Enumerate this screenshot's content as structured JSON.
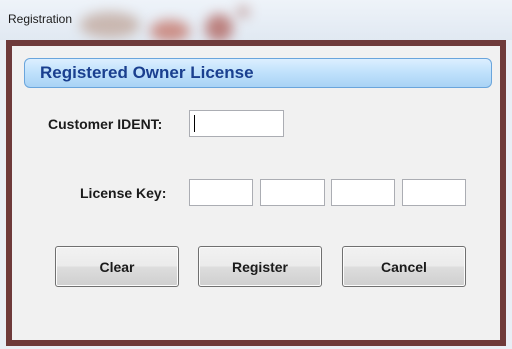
{
  "window": {
    "title": "Registration"
  },
  "header": {
    "title": "Registered Owner License"
  },
  "form": {
    "customer_ident_label": "Customer IDENT:",
    "customer_ident_value": "",
    "license_key_label": "License Key:",
    "license_key_values": [
      "",
      "",
      "",
      ""
    ]
  },
  "buttons": {
    "clear": "Clear",
    "register": "Register",
    "cancel": "Cancel"
  },
  "colors": {
    "frame_border": "#6e3a3a",
    "header_text": "#1a3f8f",
    "header_fill": "#bfe1fb"
  }
}
